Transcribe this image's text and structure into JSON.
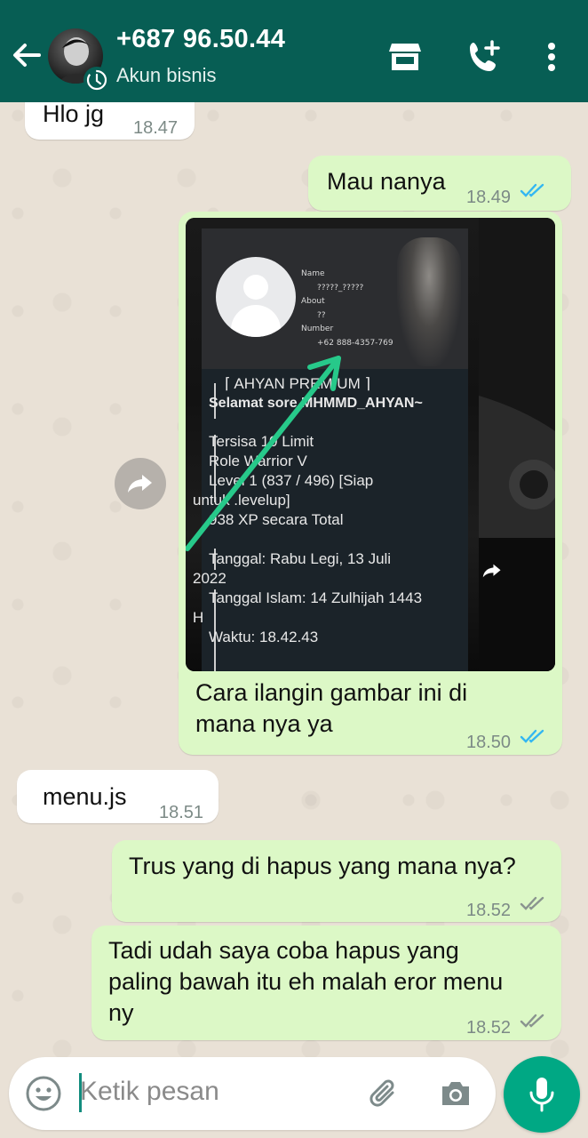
{
  "header": {
    "contact_name": "+687 96.50.44",
    "contact_sub": "Akun bisnis",
    "accent": "#075e54"
  },
  "messages": [
    {
      "dir": "in",
      "text": "Hlo jg",
      "time": "18.47"
    },
    {
      "dir": "out",
      "text": "Mau nanya",
      "time": "18.49",
      "status": "read"
    },
    {
      "dir": "out",
      "type": "image",
      "caption_line1": "Cara ilangin gambar ini di",
      "caption_line2": "mana nya ya",
      "time": "18.50",
      "status": "read"
    },
    {
      "dir": "in",
      "text": "menu.js",
      "time": "18.51"
    },
    {
      "dir": "out",
      "text": "Trus yang di hapus yang mana nya?",
      "time": "18.52",
      "status": "delivered"
    },
    {
      "dir": "out",
      "line1": "Tadi udah saya coba hapus yang",
      "line2": "paling bawah itu eh malah eror menu",
      "line3": "ny",
      "time": "18.52",
      "status": "delivered"
    }
  ],
  "image": {
    "profile": {
      "name_label": "Name",
      "name_value": "?????_?????",
      "about_label": "About",
      "about_value": "??",
      "number_label": "Number",
      "number_value": "+62 888-4357-769"
    },
    "lines": [
      "⌈ AHYAN PREMIUM ⌉",
      "Selamat sore MHMMD_AHYAN~",
      "Tersisa 10 Limit",
      "Role Warrior V",
      "Level 1 (837 / 496) [Siap",
      "untuk .levelup]",
      "938 XP secara Total",
      "Tanggal: Rabu Legi, 13 Juli",
      "2022",
      "Tanggal Islam: 14 Zulhijah 1443",
      "H",
      "Waktu: 18.42.43"
    ]
  },
  "input": {
    "placeholder": "Ketik pesan"
  },
  "colors": {
    "outgoing_bubble": "#dcf8c6",
    "incoming_bubble": "#ffffff",
    "read_tick": "#34b7f1",
    "mic_button": "#00a884"
  }
}
